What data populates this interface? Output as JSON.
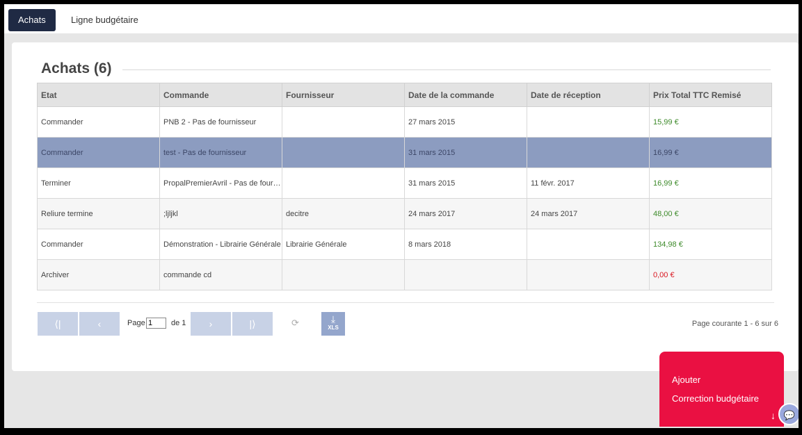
{
  "tabs": [
    "Achats",
    "Ligne budgétaire"
  ],
  "page_title": "Achats (6)",
  "table": {
    "headers": [
      "Etat",
      "Commande",
      "Fournisseur",
      "Date de la commande",
      "Date de réception",
      "Prix Total TTC Remisé"
    ],
    "rows": [
      {
        "etat": "Commander",
        "commande": "PNB 2 - Pas de fournisseur",
        "fournisseur": "",
        "date_commande": "27 mars 2015",
        "date_reception": "",
        "prix": "15,99 €",
        "prix_color": "green"
      },
      {
        "etat": "Commander",
        "commande": "test - Pas de fournisseur",
        "fournisseur": "",
        "date_commande": "31 mars 2015",
        "date_reception": "",
        "prix": "16,99 €",
        "prix_color": "green"
      },
      {
        "etat": "Terminer",
        "commande": "PropalPremierAvril - Pas de fournisseur",
        "fournisseur": "",
        "date_commande": "31 mars 2015",
        "date_reception": "11 févr. 2017",
        "prix": "16,99 €",
        "prix_color": "green"
      },
      {
        "etat": "Reliure termine",
        "commande": ";ljljkl",
        "fournisseur": "decitre",
        "date_commande": "24 mars 2017",
        "date_reception": "24 mars 2017",
        "prix": "48,00 €",
        "prix_color": "green"
      },
      {
        "etat": "Commander",
        "commande": "Démonstration - Librairie Générale",
        "fournisseur": "Librairie Générale",
        "date_commande": "8 mars 2018",
        "date_reception": "",
        "prix": "134,98 €",
        "prix_color": "green"
      },
      {
        "etat": "Archiver",
        "commande": "commande cd",
        "fournisseur": "",
        "date_commande": "",
        "date_reception": "",
        "prix": "0,00 €",
        "prix_color": "red"
      }
    ],
    "selected_row": 1
  },
  "pagination": {
    "page_label": "Page",
    "page_value": "1",
    "of_label": "de 1",
    "xls_label": "XLS",
    "status": "Page courante 1 - 6 sur 6"
  },
  "actions": [
    "Ajouter",
    "Correction budgétaire"
  ],
  "colors": {
    "accent_dark": "#1f2a44",
    "selected_row": "#8c9cc0",
    "action_panel": "#ea1042",
    "price_green": "#3d8a2a",
    "price_red": "#d9141e"
  }
}
